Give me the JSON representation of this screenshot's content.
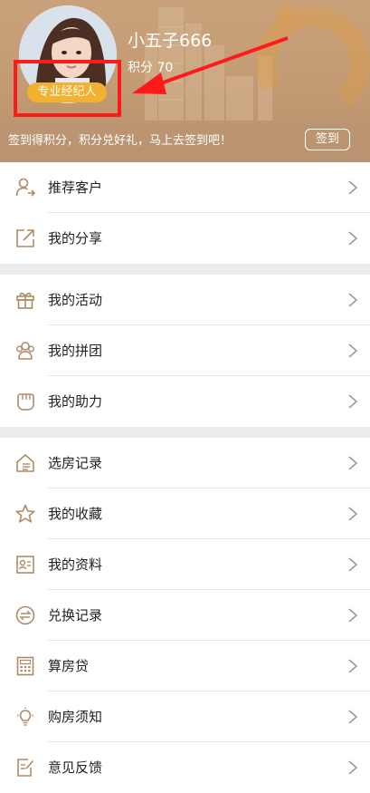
{
  "profile": {
    "username": "小五子666",
    "points_label": "积分 70",
    "badge_label": "专业经纪人"
  },
  "signin": {
    "prompt": "签到得积分，积分兑好礼，马上去签到吧！",
    "button_label": "签到"
  },
  "colors": {
    "accent": "#c29a73",
    "badge": "#f2b12f",
    "icon": "#b08a66",
    "annotation": "#ff1a1a"
  },
  "menu": {
    "group1": [
      {
        "label": "推荐客户",
        "icon": "user-arrow-icon"
      },
      {
        "label": "我的分享",
        "icon": "share-icon"
      }
    ],
    "group2": [
      {
        "label": "我的活动",
        "icon": "gift-icon"
      },
      {
        "label": "我的拼团",
        "icon": "group-icon"
      },
      {
        "label": "我的助力",
        "icon": "fist-icon"
      }
    ],
    "group3": [
      {
        "label": "选房记录",
        "icon": "house-record-icon"
      },
      {
        "label": "我的收藏",
        "icon": "star-icon"
      },
      {
        "label": "我的资料",
        "icon": "id-card-icon"
      },
      {
        "label": "兑换记录",
        "icon": "exchange-icon"
      },
      {
        "label": "算房贷",
        "icon": "calculator-icon"
      },
      {
        "label": "购房须知",
        "icon": "lightbulb-icon"
      },
      {
        "label": "意见反馈",
        "icon": "feedback-icon"
      }
    ]
  }
}
